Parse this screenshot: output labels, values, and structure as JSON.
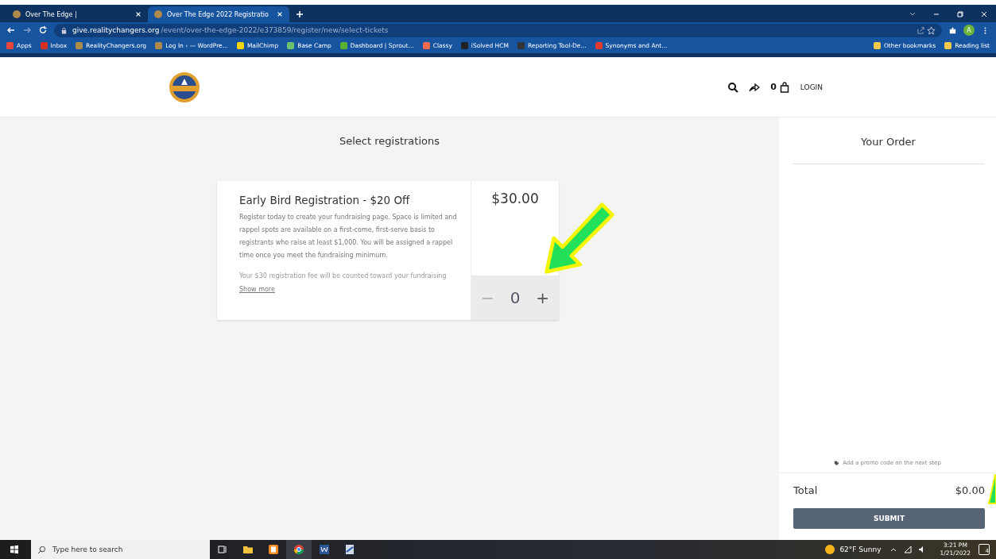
{
  "browser": {
    "tabs": [
      {
        "title": "Over The Edge |",
        "selected": false
      },
      {
        "title": "Over The Edge 2022 Registratio",
        "selected": true
      }
    ],
    "url": {
      "domain": "give.realitychangers.org",
      "path": "/event/over-the-edge-2022/e373859/register/new/select-tickets"
    },
    "bookmarks": [
      {
        "label": "Apps",
        "color": "#e8453c"
      },
      {
        "label": "Inbox",
        "color": "#d93025"
      },
      {
        "label": "RealityChangers.org",
        "color": "#b08a4a"
      },
      {
        "label": "Log In ‹ — WordPre...",
        "color": "#b08a4a"
      },
      {
        "label": "MailChimp",
        "color": "#f5d800"
      },
      {
        "label": "Base Camp",
        "color": "#6cc070"
      },
      {
        "label": "Dashboard | Sprout...",
        "color": "#59b031"
      },
      {
        "label": "Classy",
        "color": "#f26b4f"
      },
      {
        "label": "iSolved HCM",
        "color": "#222222"
      },
      {
        "label": "Reporting Tool-De...",
        "color": "#333333"
      },
      {
        "label": "Synonyms and Ant...",
        "color": "#e03a2f"
      }
    ],
    "bookmarks_right": [
      "Other bookmarks",
      "Reading list"
    ],
    "profile_initial": "A"
  },
  "header": {
    "cart_count": "0",
    "login": "LOGIN"
  },
  "main": {
    "title": "Select registrations",
    "ticket": {
      "name": "Early Bird Registration - $20 Off",
      "description": "Register today to create your fundraising page. Space is limited and rappel spots are available on a first-come, first-serve basis to registrants who raise at least $1,000. You will be assigned a rappel time once you meet the fundraising minimum.",
      "description_faded": "Your $30 registration fee will be counted toward your fundraising",
      "show_more": "Show more",
      "price": "$30.00",
      "quantity": "0",
      "minus": "−",
      "plus": "+"
    }
  },
  "order": {
    "title": "Your Order",
    "promo": "Add a promo code on the next step",
    "total_label": "Total",
    "total": "$0.00",
    "submit": "SUBMIT"
  },
  "taskbar": {
    "search_placeholder": "Type here to search",
    "weather": "62°F  Sunny",
    "time": "3:21 PM",
    "date": "1/21/2022",
    "notifications": "4"
  }
}
